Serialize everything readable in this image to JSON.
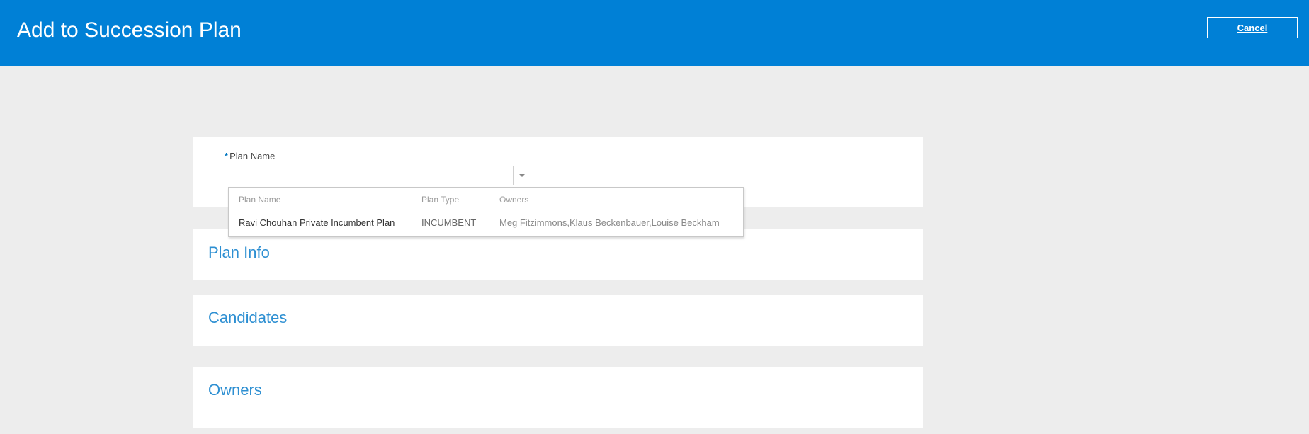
{
  "header": {
    "title": "Add to Succession Plan",
    "cancel_label": "Cancel"
  },
  "plan_field": {
    "required_marker": "*",
    "label": "Plan Name",
    "value": ""
  },
  "dropdown": {
    "headers": {
      "name": "Plan Name",
      "type": "Plan Type",
      "owners": "Owners"
    },
    "rows": [
      {
        "name": "Ravi Chouhan Private Incumbent Plan",
        "type": "INCUMBENT",
        "owners": "Meg Fitzimmons,Klaus Beckenbauer,Louise Beckham"
      }
    ]
  },
  "sections": {
    "plan_info": "Plan Info",
    "candidates": "Candidates",
    "owners": "Owners"
  }
}
